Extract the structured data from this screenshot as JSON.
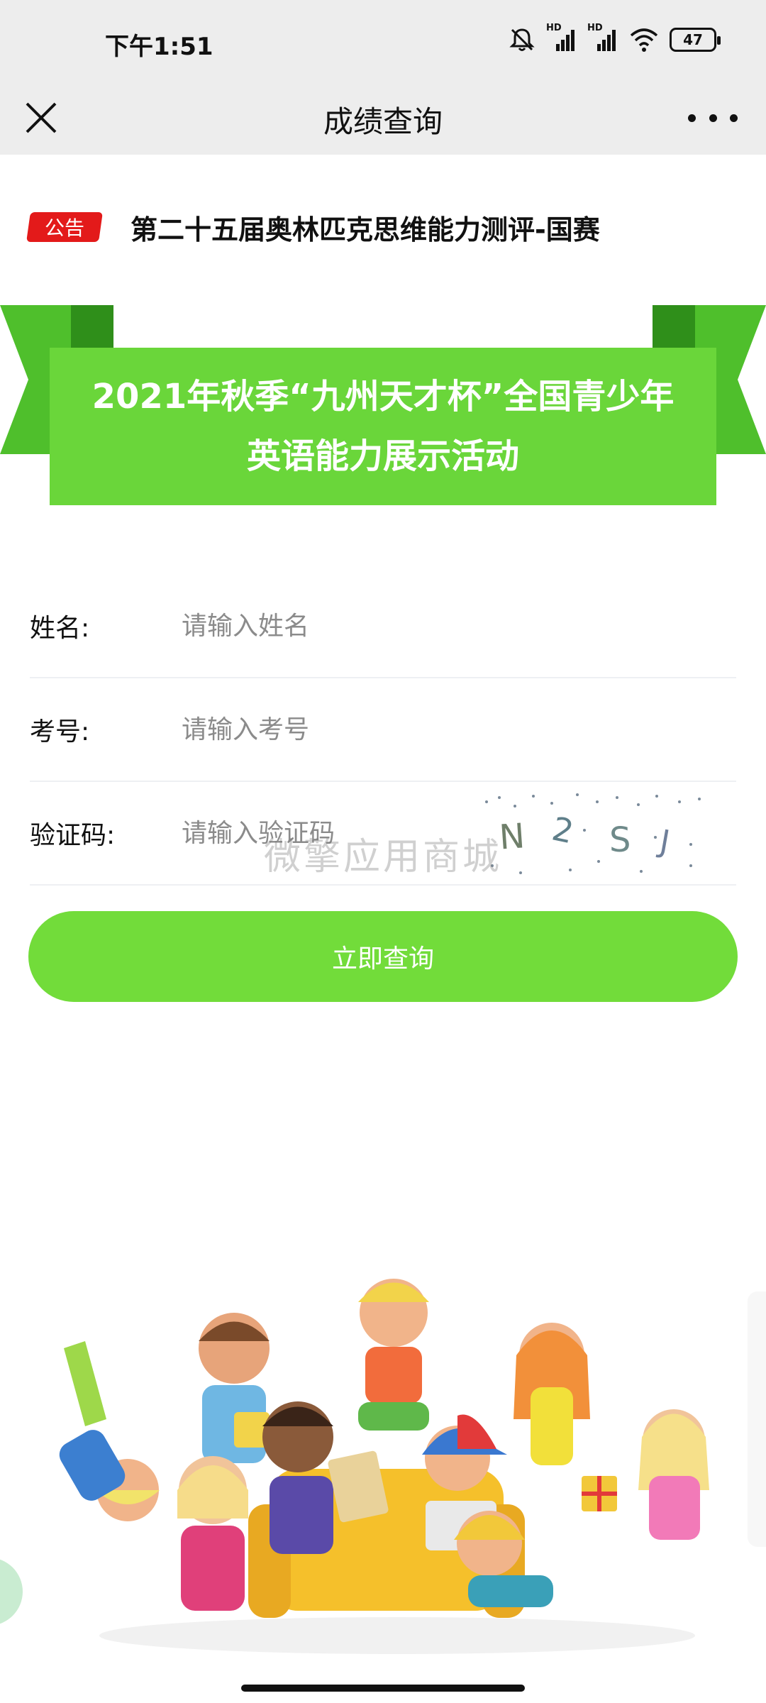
{
  "status_bar": {
    "time": "下午1:51",
    "hd_1": "HD",
    "hd_2": "HD",
    "battery": "47"
  },
  "nav": {
    "title": "成绩查询"
  },
  "notice": {
    "tag": "公告",
    "text": "第二十五届奥林匹克思维能力测评-国赛"
  },
  "banner": {
    "line1": "2021年秋季“九州天才杯”全国青少年",
    "line2": "英语能力展示活动"
  },
  "form": {
    "name": {
      "label": "姓名:",
      "placeholder": "请输入姓名"
    },
    "exam_no": {
      "label": "考号:",
      "placeholder": "请输入考号"
    },
    "captcha": {
      "label": "验证码:",
      "placeholder": "请输入验证码",
      "chars": [
        "N",
        "2",
        "S",
        "J"
      ]
    }
  },
  "watermark": "微擎应用商城",
  "submit_label": "立即查询",
  "colors": {
    "accent": "#6ad63a",
    "notice_red": "#e31a1a",
    "bar_bg": "#ededed"
  }
}
